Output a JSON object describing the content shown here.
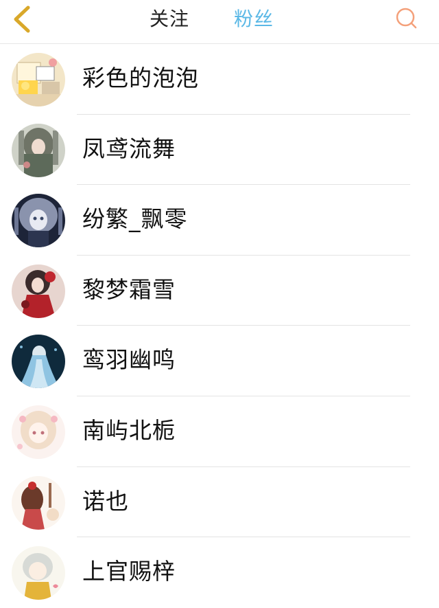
{
  "header": {
    "tabs": [
      {
        "label": "关注"
      },
      {
        "label": "粉丝"
      }
    ],
    "accent_color": "#5ab8e6",
    "back_icon_color": "#d9a82a",
    "search_icon_color": "#f4a07a"
  },
  "fans": [
    {
      "name": "彩色的泡泡"
    },
    {
      "name": "凤鸢流舞"
    },
    {
      "name": "纷繁_飘零"
    },
    {
      "name": "黎梦霜雪"
    },
    {
      "name": "鸾羽幽鸣"
    },
    {
      "name": "南屿北栀"
    },
    {
      "name": "诺也"
    },
    {
      "name": "上官赐梓"
    }
  ]
}
